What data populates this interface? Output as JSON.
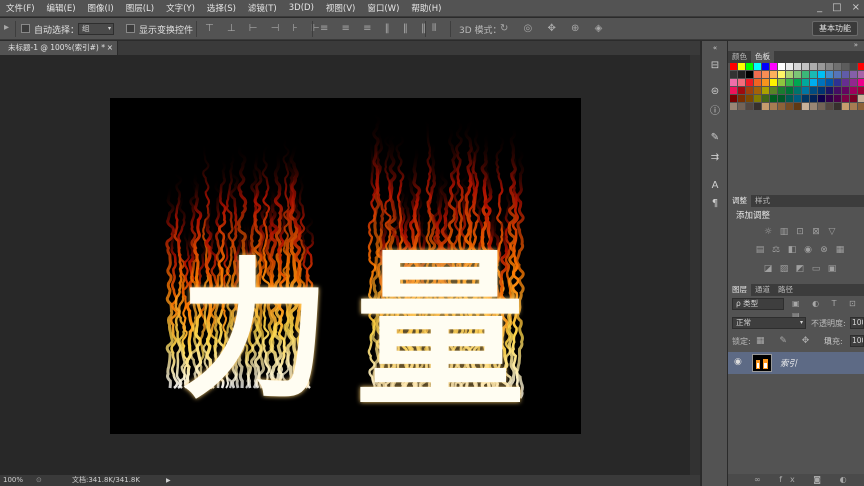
{
  "menu": [
    "文件(F)",
    "编辑(E)",
    "图像(I)",
    "图层(L)",
    "文字(Y)",
    "选择(S)",
    "滤镜(T)",
    "3D(D)",
    "视图(V)",
    "窗口(W)",
    "帮助(H)"
  ],
  "window_controls": [
    "_",
    "□",
    "×"
  ],
  "options": {
    "auto_select_label": "自动选择：",
    "auto_select_value": "组",
    "show_transform_label": "显示变换控件",
    "mode_3d_label": "3D 模式：",
    "workspace_label": "基本功能"
  },
  "document_tab": {
    "title": "未标题-1 @ 100%(索引#) *",
    "close": "×"
  },
  "canvas_text": [
    "力",
    "量"
  ],
  "status": {
    "zoom": "100%",
    "doc_info": "文档:341.8K/341.8K"
  },
  "panels": {
    "color_tabs": [
      "颜色",
      "色板"
    ],
    "adjust_tabs": [
      "调整",
      "样式"
    ],
    "adjust_title": "添加调整",
    "layer_tabs": [
      "图层",
      "通道",
      "路径"
    ],
    "kind_filter": "ρ 类型",
    "blend_mode": "正常",
    "opacity_label": "不透明度:",
    "opacity_value": "100",
    "lock_label": "锁定:",
    "fill_label": "填充:",
    "fill_value": "100",
    "layer_name": "索引"
  },
  "colors": {
    "ui_bg": "#535353",
    "canvas_bg": "#000000",
    "layer_selected": "#5d6a85"
  }
}
